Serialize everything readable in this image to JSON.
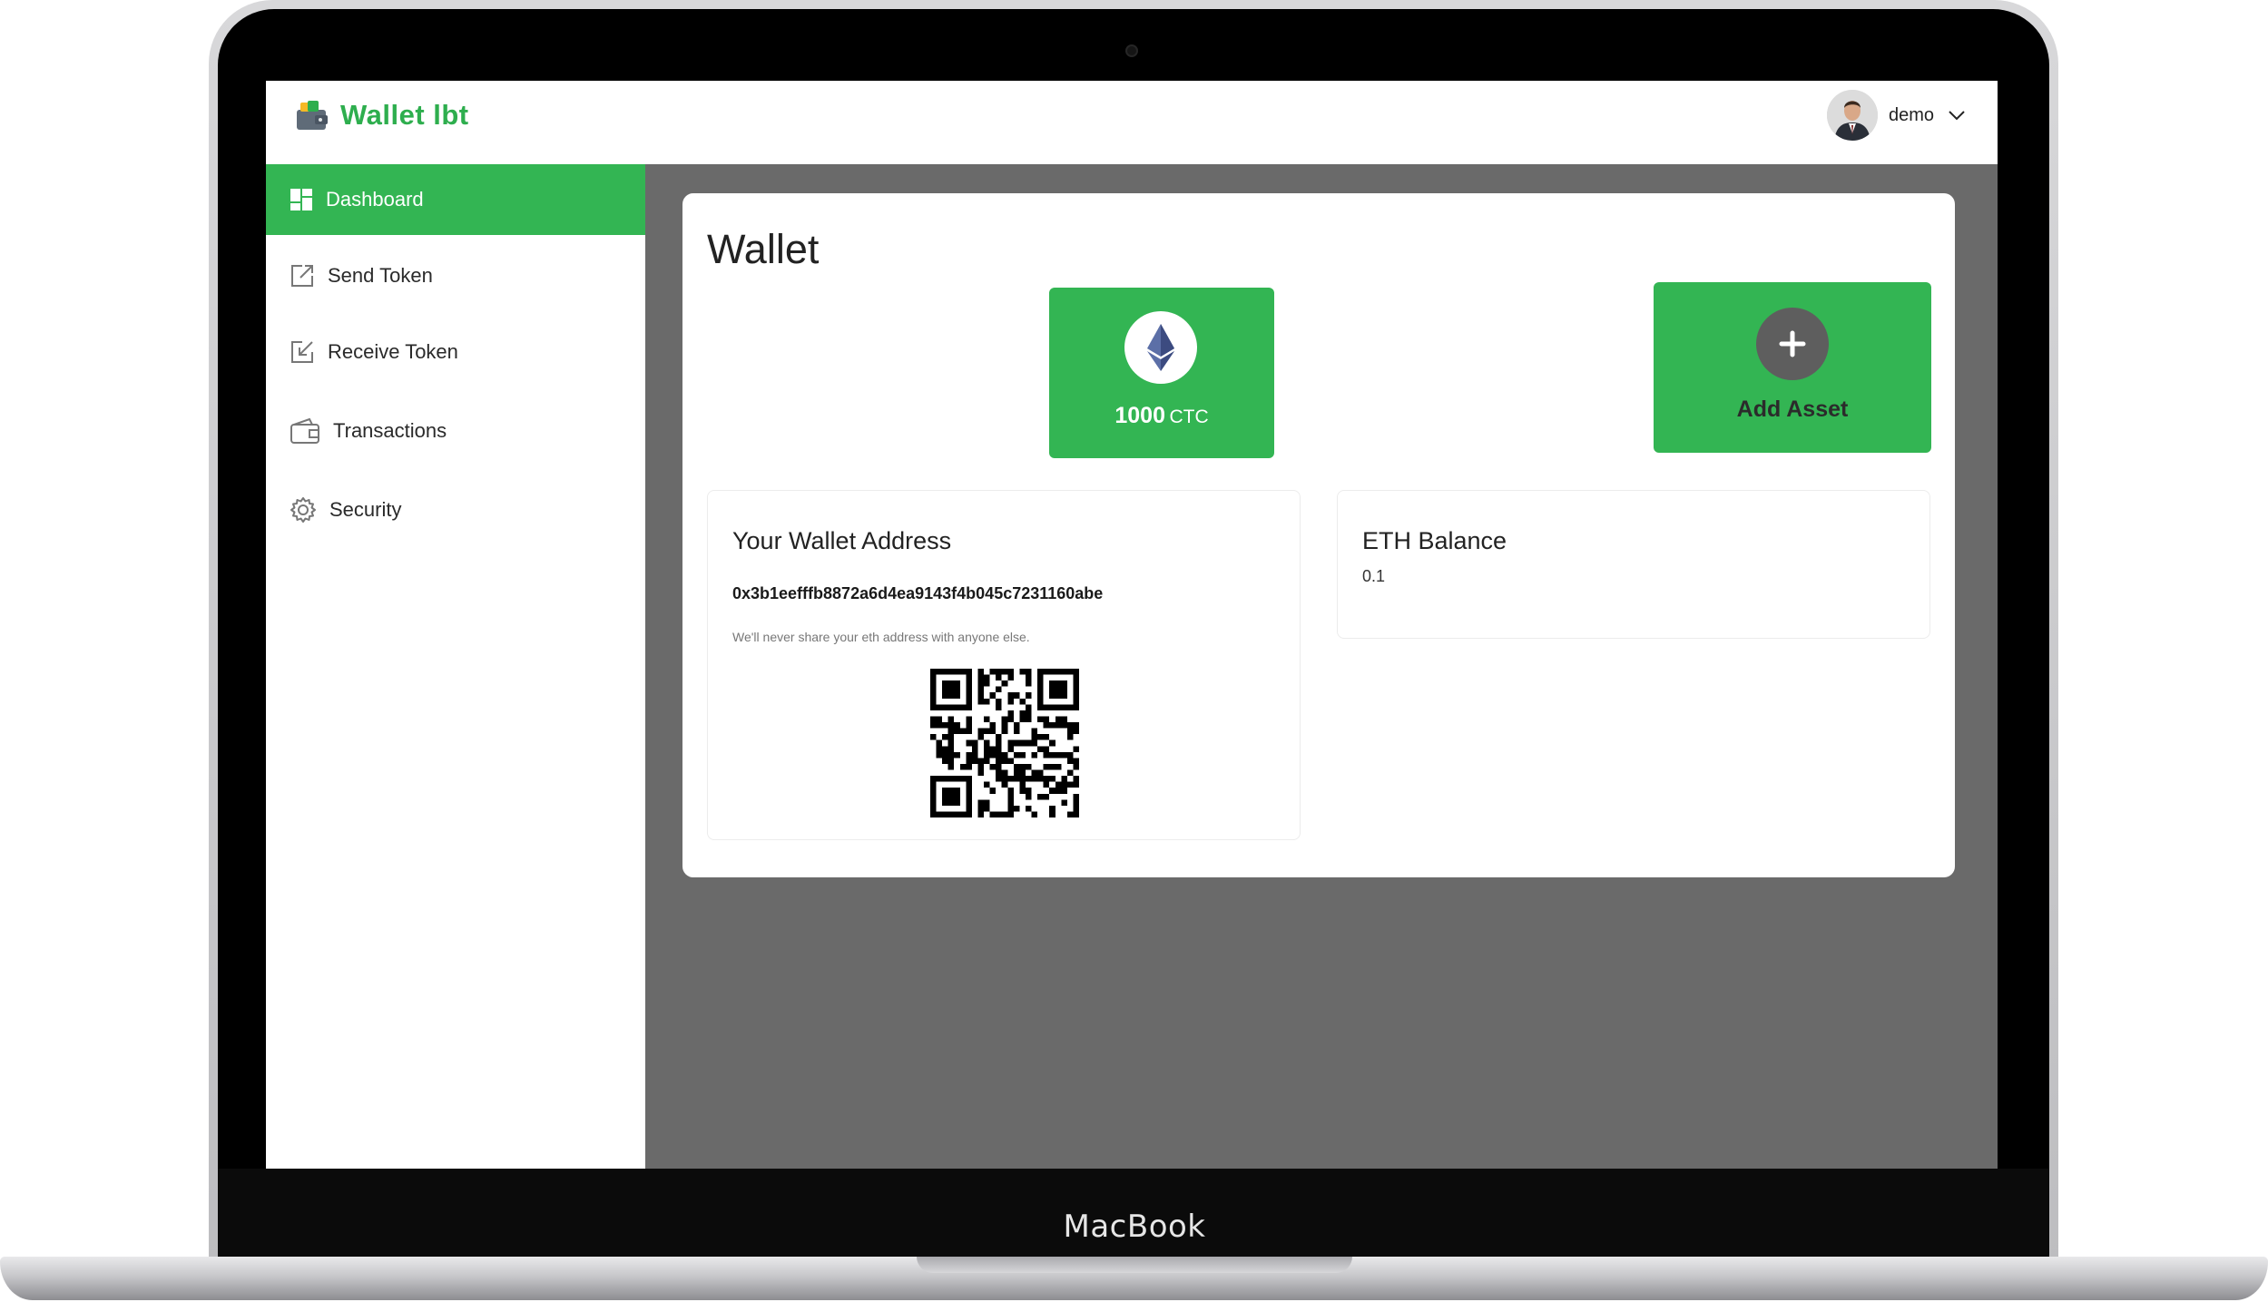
{
  "device": {
    "brand_label": "MacBook"
  },
  "app": {
    "title": "Wallet lbt"
  },
  "user": {
    "name": "demo"
  },
  "sidebar": {
    "items": [
      {
        "label": "Dashboard",
        "icon": "dashboard-icon",
        "active": true
      },
      {
        "label": "Send Token",
        "icon": "send-icon",
        "active": false
      },
      {
        "label": "Receive Token",
        "icon": "receive-icon",
        "active": false
      },
      {
        "label": "Transactions",
        "icon": "wallet-icon",
        "active": false
      },
      {
        "label": "Security",
        "icon": "gear-icon",
        "active": false
      }
    ]
  },
  "main": {
    "title": "Wallet",
    "token": {
      "amount": "1000",
      "unit": "CTC",
      "icon": "ethereum-icon"
    },
    "add_asset": {
      "label": "Add Asset",
      "icon": "plus-icon"
    },
    "address_card": {
      "title": "Your Wallet Address",
      "address": "0x3b1eefffb8872a6d4ea9143f4b045c7231160abe",
      "note": "We'll never share your eth address with anyone else."
    },
    "eth_card": {
      "title": "ETH Balance",
      "value": "0.1"
    }
  },
  "colors": {
    "accent": "#33b553",
    "logo_text": "#2eae4e",
    "content_bg": "#6a6a6a",
    "add_circle": "#5e5e5e"
  }
}
